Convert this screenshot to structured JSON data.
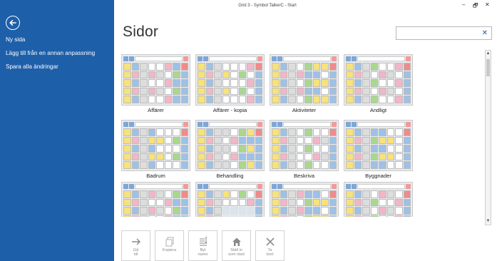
{
  "window": {
    "title": "Grid 3 - Symbol TalkerC - Start",
    "controls": {
      "minimize": "–",
      "restore": "🗗",
      "close": "✕"
    }
  },
  "sidebar": {
    "back_icon": "arrow-left-circle-icon",
    "items": [
      {
        "label": "Ny sida"
      },
      {
        "label": "Lägg till från en annan anpassning"
      },
      {
        "label": "Spara alla ändringar"
      }
    ]
  },
  "main": {
    "title": "Sidor",
    "search": {
      "value": "",
      "clear_icon": "✕"
    }
  },
  "pages": [
    {
      "label": "Affärer"
    },
    {
      "label": "Affärer - kopia"
    },
    {
      "label": "Aktiviteter"
    },
    {
      "label": "Andligt"
    },
    {
      "label": "Badrum"
    },
    {
      "label": "Behandling"
    },
    {
      "label": "Beskriva"
    },
    {
      "label": "Byggnader"
    },
    {
      "label": ""
    },
    {
      "label": ""
    },
    {
      "label": ""
    },
    {
      "label": ""
    }
  ],
  "actions": [
    {
      "line1": "Gå",
      "line2": "till",
      "icon": "arrow-right-icon"
    },
    {
      "line1": "Kopiera",
      "line2": "",
      "icon": "copy-icon"
    },
    {
      "line1": "Byt",
      "line2": "namn",
      "icon": "rename-icon"
    },
    {
      "line1": "Ställ in",
      "line2": "som start",
      "icon": "home-icon"
    },
    {
      "line1": "Ta",
      "line2": "bort",
      "icon": "delete-x-icon"
    }
  ],
  "colors": {
    "sidebar_bg": "#1e5faa",
    "accent": "#1e5faa"
  }
}
